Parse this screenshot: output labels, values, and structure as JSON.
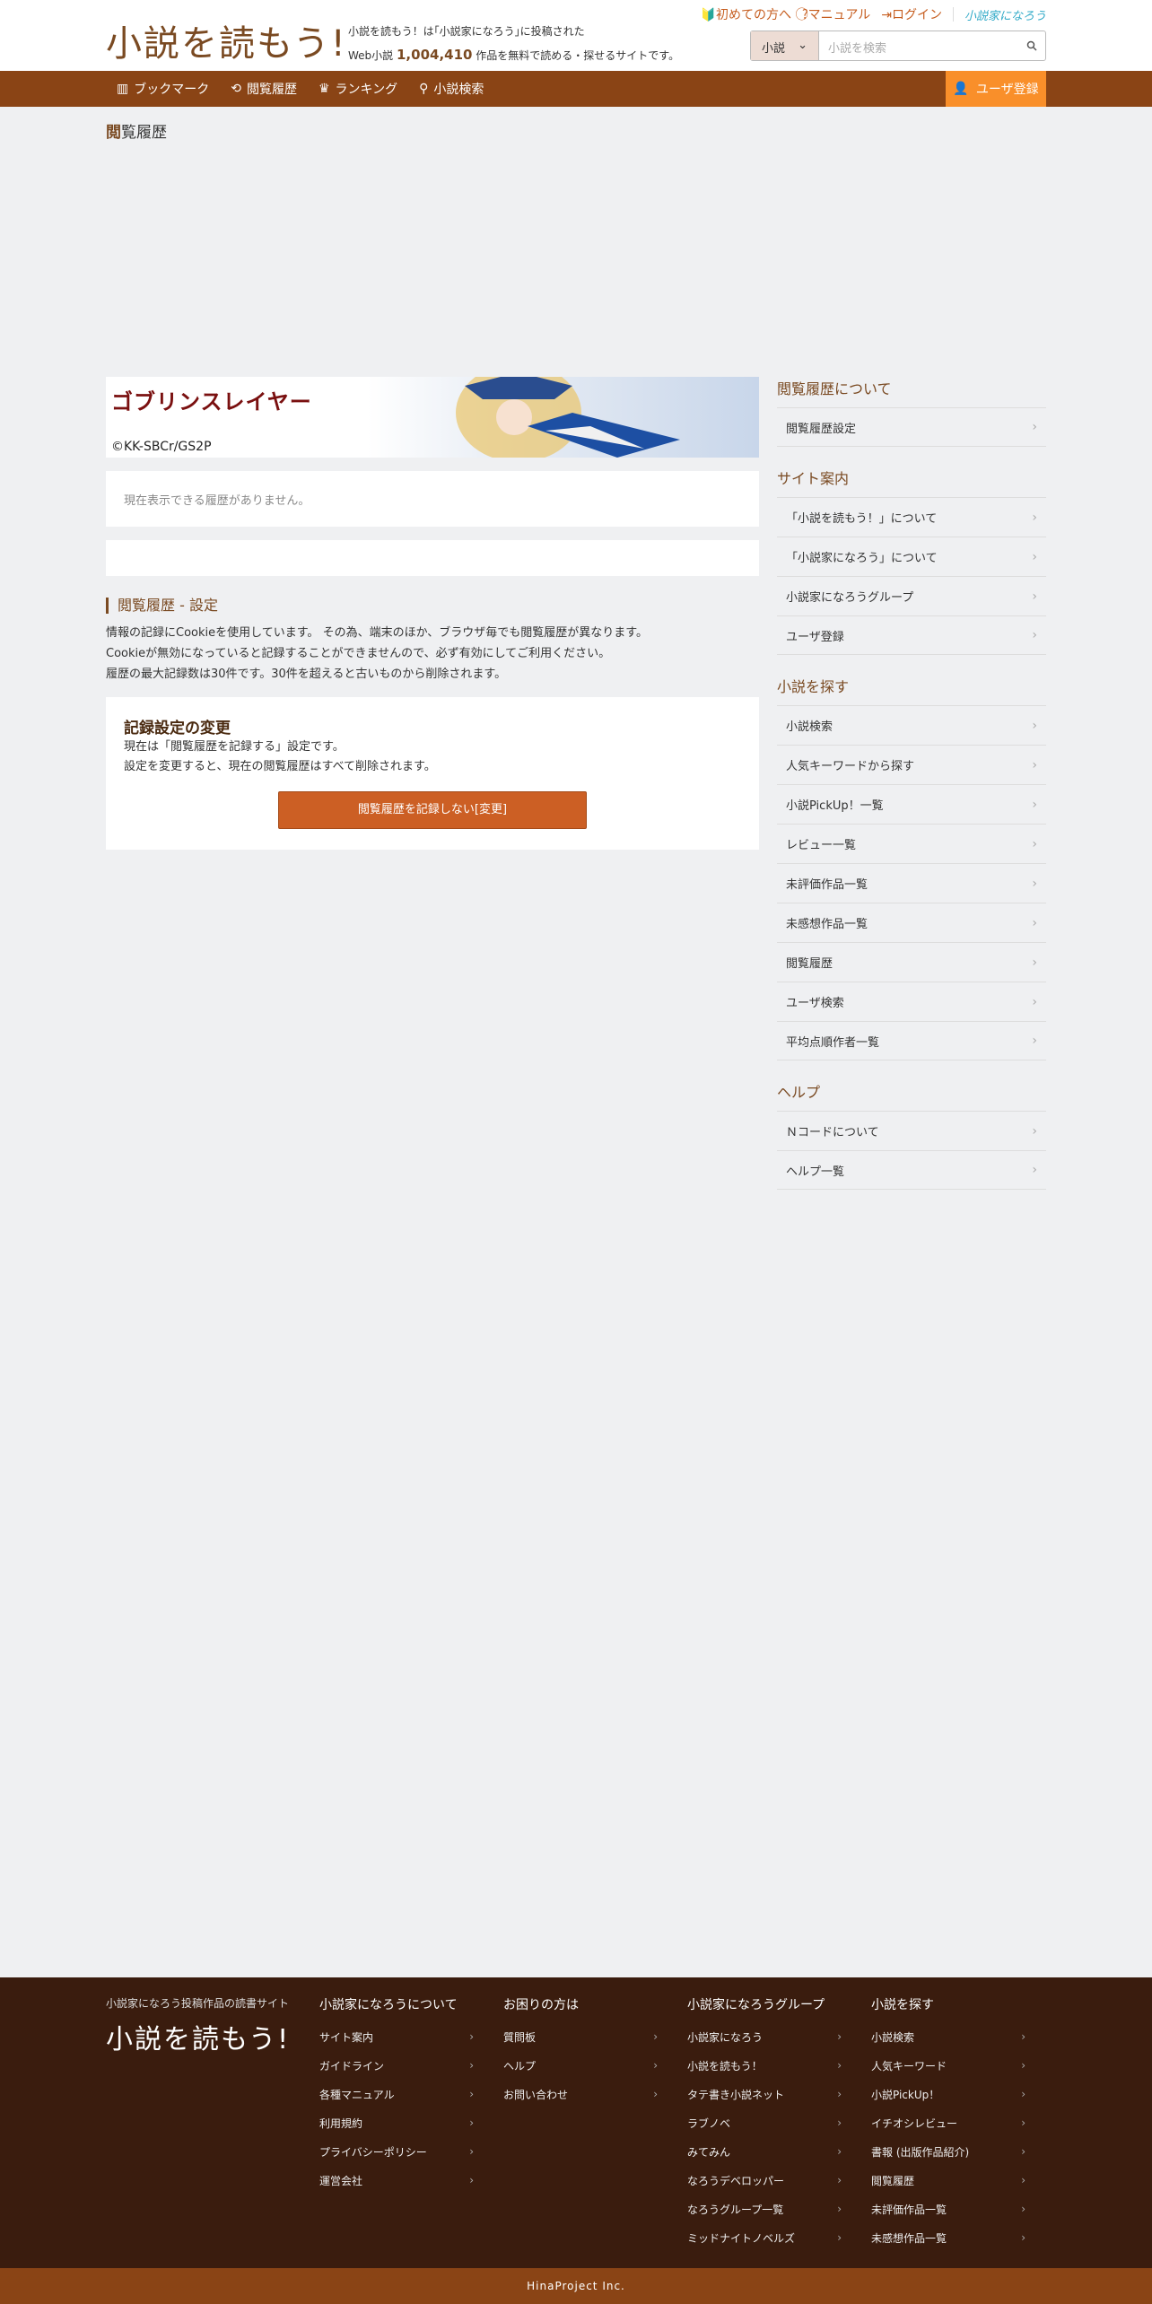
{
  "header": {
    "logo": "小説を読もう!",
    "tagline_line1": "小説を読もう！は｢小説家になろう｣に投稿された",
    "tagline_prefix": "Web小説",
    "count": "1,004,410",
    "tagline_suffix": "作品を無料で読める・探せるサイトです。",
    "links": [
      "初めての方へ",
      "マニュアル",
      "ログイン"
    ],
    "narou_logo": "小説家になろう",
    "search_select": "小説",
    "search_placeholder": "小説を検索"
  },
  "nav": {
    "items": [
      "ブックマーク",
      "閲覧履歴",
      "ランキング",
      "小説検索"
    ],
    "register": "ユーザ登録"
  },
  "page_title": {
    "first": "閲",
    "rest": "覧履歴"
  },
  "main": {
    "banner_title": "ゴブリンスレイヤー",
    "banner_copy": "©KK-SBCr/GS2P",
    "empty_text": "現在表示できる履歴がありません。",
    "section_heading": "閲覧履歴 - 設定",
    "desc": [
      "情報の記録にCookieを使用しています。 その為、端末のほか、ブラウザ毎でも閲覧履歴が異なります。",
      "Cookieが無効になっていると記録することができませんので、必ず有効にしてご利用ください。",
      "履歴の最大記録数は30件です。30件を超えると古いものから削除されます。"
    ],
    "setting_title": "記録設定の変更",
    "setting_lines": [
      "現在は「閲覧履歴を記録する」設定です。",
      "設定を変更すると、現在の閲覧履歴はすべて削除されます。"
    ],
    "change_button": "閲覧履歴を記録しない[変更]"
  },
  "sidebar": [
    {
      "title": "閲覧履歴について",
      "items": [
        "閲覧履歴設定"
      ]
    },
    {
      "title": "サイト案内",
      "items": [
        "「小説を読もう！」について",
        "「小説家になろう」について",
        "小説家になろうグループ",
        "ユーザ登録"
      ]
    },
    {
      "title": "小説を探す",
      "items": [
        "小説検索",
        "人気キーワードから探す",
        "小説PickUp！一覧",
        "レビュー一覧",
        "未評価作品一覧",
        "未感想作品一覧",
        "閲覧履歴",
        "ユーザ検索",
        "平均点順作者一覧"
      ]
    },
    {
      "title": "ヘルプ",
      "items": [
        "Ｎコードについて",
        "ヘルプ一覧"
      ]
    }
  ],
  "footer": {
    "brand": "小説家になろう投稿作品の読書サイト",
    "logo": "小説を読もう!",
    "columns": [
      {
        "title": "小説家になろうについて",
        "items": [
          "サイト案内",
          "ガイドライン",
          "各種マニュアル",
          "利用規約",
          "プライバシーポリシー",
          "運営会社"
        ]
      },
      {
        "title": "お困りの方は",
        "items": [
          "質問板",
          "ヘルプ",
          "お問い合わせ"
        ]
      },
      {
        "title": "小説家になろうグループ",
        "items": [
          "小説家になろう",
          "小説を読もう！",
          "タテ書き小説ネット",
          "ラブノベ",
          "みてみん",
          "なろうデベロッパー",
          "なろうグループ一覧",
          "ミッドナイトノベルズ"
        ]
      },
      {
        "title": "小説を探す",
        "items": [
          "小説検索",
          "人気キーワード",
          "小説PickUp！",
          "イチオシレビュー",
          "書報 (出版作品紹介)",
          "閲覧履歴",
          "未評価作品一覧",
          "未感想作品一覧"
        ]
      }
    ],
    "copyright": "HinaProject Inc."
  },
  "colors": {
    "brown": "#8a4415",
    "orange": "#f98f2a",
    "button": "#cc5f24",
    "footer_bg": "#3a1c0e"
  }
}
